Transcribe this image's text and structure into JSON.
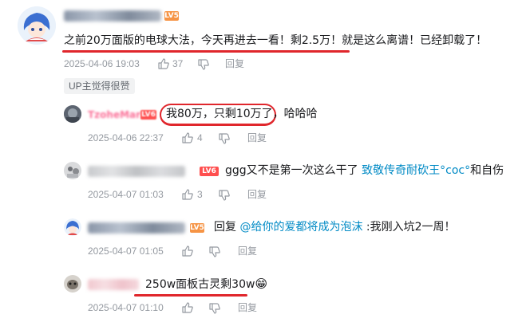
{
  "main_comment": {
    "content": "之前20万面版的电球大法，今天再进去一看！剩2.5万！就是这么离谱！已经卸载了！",
    "date": "2025-04-06 19:03",
    "likes": "37",
    "reply_label": "回复",
    "up_badge": "UP主觉得很赞",
    "level": "LV5",
    "avatar_icon": "anime-avatar-icon"
  },
  "replies": [
    {
      "username": "TzoheMar",
      "level": "LV6",
      "content": "我80万，只剩10万了，哈哈哈",
      "date": "2025-04-06 22:37",
      "likes": "4",
      "reply_label": "回复"
    },
    {
      "level": "LV6",
      "content_prefix": "ggg又不是第一次这么干了 ",
      "content_link": "致敬传奇耐砍王",
      "content_emote_1": "°coc°",
      "content_suffix": "和自伤",
      "date": "2025-04-07 01:03",
      "likes": "3",
      "reply_label": "回复"
    },
    {
      "level": "LV5",
      "content_reply_word": "回复 ",
      "content_mention": "@给你的爱都将成为泡沫",
      "content_text": " :我刚入坑2一周！",
      "date": "2025-04-07 01:05",
      "likes": "",
      "reply_label": "回复"
    },
    {
      "content": "250w面板古灵剩30w",
      "emoji": "😁",
      "date": "2025-04-07 01:10",
      "likes": "",
      "reply_label": "回复"
    }
  ],
  "colors": {
    "annotation_red": "#e0262c",
    "link_blue": "#008ac5",
    "meta_gray": "#9499a0",
    "level_orange": "#f69445",
    "level_red": "#ff4f4f"
  }
}
